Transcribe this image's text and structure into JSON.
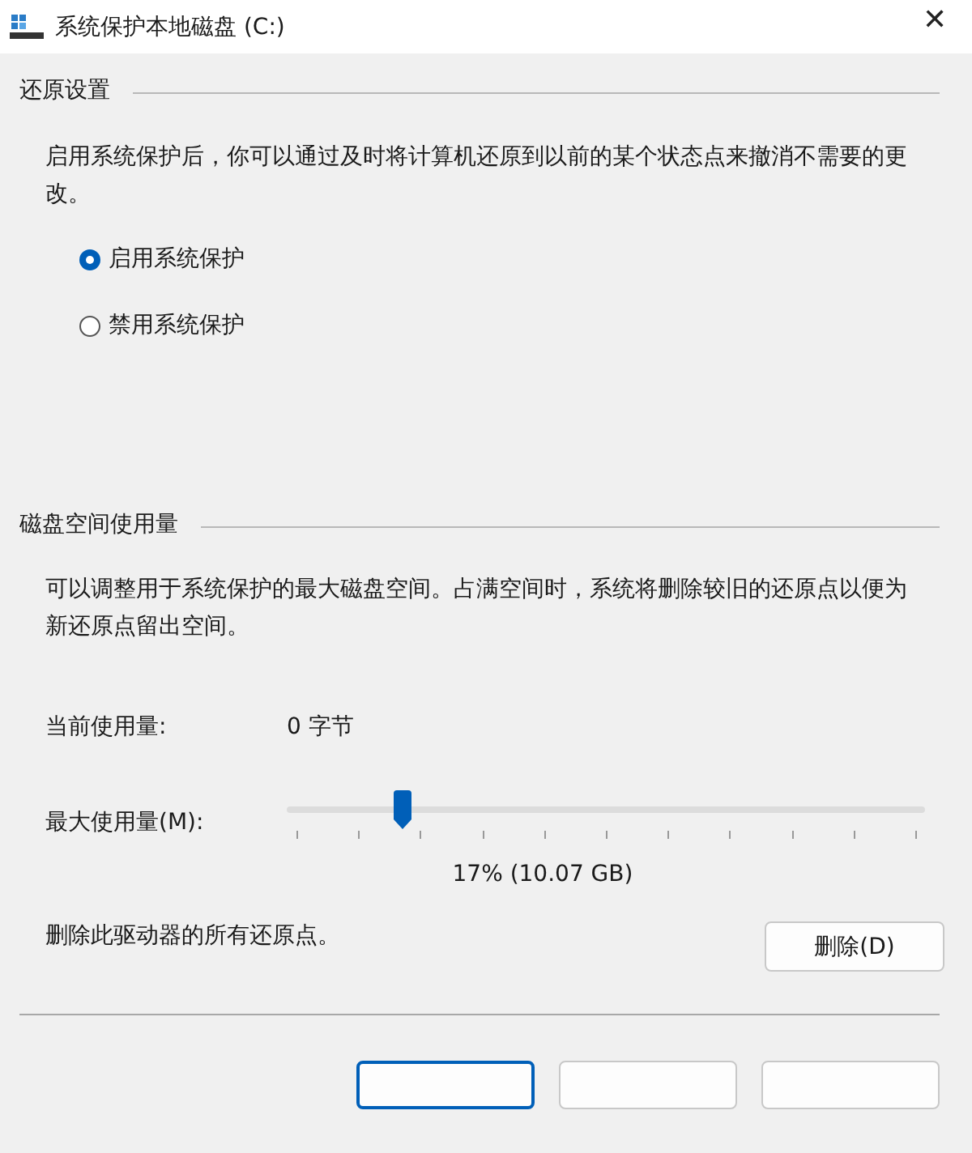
{
  "window": {
    "title": "系统保护本地磁盘 (C:)",
    "close": "✕"
  },
  "restore_settings": {
    "heading": "还原设置",
    "description": "启用系统保护后，你可以通过及时将计算机还原到以前的某个状态点来撤消不需要的更改。",
    "options": [
      {
        "label": "启用系统保护",
        "selected": true
      },
      {
        "label": "禁用系统保护",
        "selected": false
      }
    ]
  },
  "disk_usage": {
    "heading": "磁盘空间使用量",
    "description": "可以调整用于系统保护的最大磁盘空间。占满空间时，系统将删除较旧的还原点以便为新还原点留出空间。",
    "current_label": "当前使用量:",
    "current_value": "0 字节",
    "max_label": "最大使用量(M):",
    "max_slider": {
      "level": 0.18
    },
    "max_reading": "17% (10.07 GB)",
    "delete_text": "删除此驱动器的所有还原点。",
    "delete_button": "删除(D)"
  },
  "footer_buttons": [
    {
      "default": true
    },
    {
      "default": false
    },
    {
      "default": false
    }
  ]
}
